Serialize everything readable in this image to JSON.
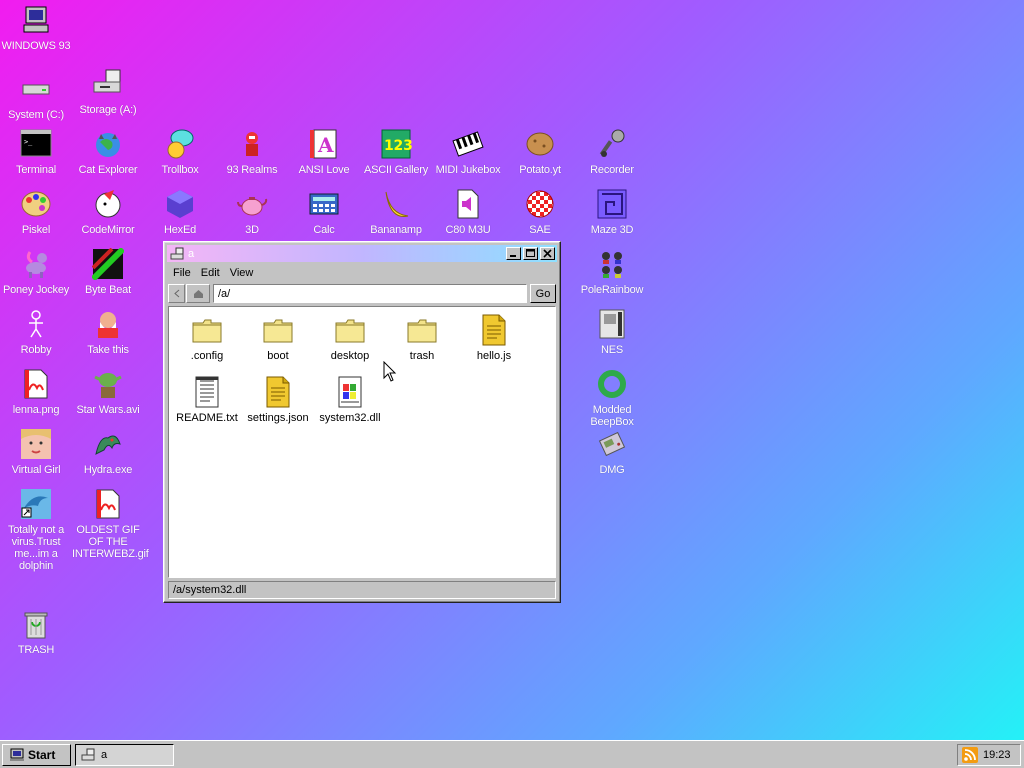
{
  "desktop": {
    "icons": [
      {
        "label": "WINDOWS 93"
      },
      {
        "label": "System (C:)"
      },
      {
        "label": "Storage (A:)"
      },
      {
        "label": "Terminal"
      },
      {
        "label": "Cat Explorer"
      },
      {
        "label": "Trollbox"
      },
      {
        "label": "93 Realms"
      },
      {
        "label": "ANSI Love"
      },
      {
        "label": "ASCII Gallery"
      },
      {
        "label": "MIDI Jukebox"
      },
      {
        "label": "Potato.yt"
      },
      {
        "label": "Recorder"
      },
      {
        "label": "Piskel"
      },
      {
        "label": "CodeMirror"
      },
      {
        "label": "HexEd"
      },
      {
        "label": "3D"
      },
      {
        "label": "Calc"
      },
      {
        "label": "Bananamp"
      },
      {
        "label": "C80 M3U"
      },
      {
        "label": "SAE"
      },
      {
        "label": "Maze 3D"
      },
      {
        "label": "Poney Jockey"
      },
      {
        "label": "Byte Beat"
      },
      {
        "label": "PoleRainbow"
      },
      {
        "label": "Robby"
      },
      {
        "label": "Take this"
      },
      {
        "label": "NES"
      },
      {
        "label": "lenna.png"
      },
      {
        "label": "Star Wars.avi"
      },
      {
        "label": "Modded BeepBox"
      },
      {
        "label": "Virtual Girl"
      },
      {
        "label": "Hydra.exe"
      },
      {
        "label": "DMG"
      },
      {
        "label": "Totally not a virus.Trust me...im a dolphin"
      },
      {
        "label": "OLDEST GIF OF THE INTERWEBZ.gif"
      },
      {
        "label": "TRASH"
      }
    ]
  },
  "window": {
    "title": "a",
    "menu": [
      "File",
      "Edit",
      "View"
    ],
    "address": "/a/",
    "go_label": "Go",
    "files": [
      {
        "name": ".config",
        "type": "folder"
      },
      {
        "name": "boot",
        "type": "folder"
      },
      {
        "name": "desktop",
        "type": "folder"
      },
      {
        "name": "trash",
        "type": "folder"
      },
      {
        "name": "hello.js",
        "type": "js"
      },
      {
        "name": "README.txt",
        "type": "txt"
      },
      {
        "name": "settings.json",
        "type": "json"
      },
      {
        "name": "system32.dll",
        "type": "dll"
      }
    ],
    "status": "/a/system32.dll"
  },
  "taskbar": {
    "start_label": "Start",
    "task_label": "a",
    "clock": "19:23"
  },
  "colors": {
    "folder": "#f3e38a",
    "chrome": "#c3c3c3"
  }
}
